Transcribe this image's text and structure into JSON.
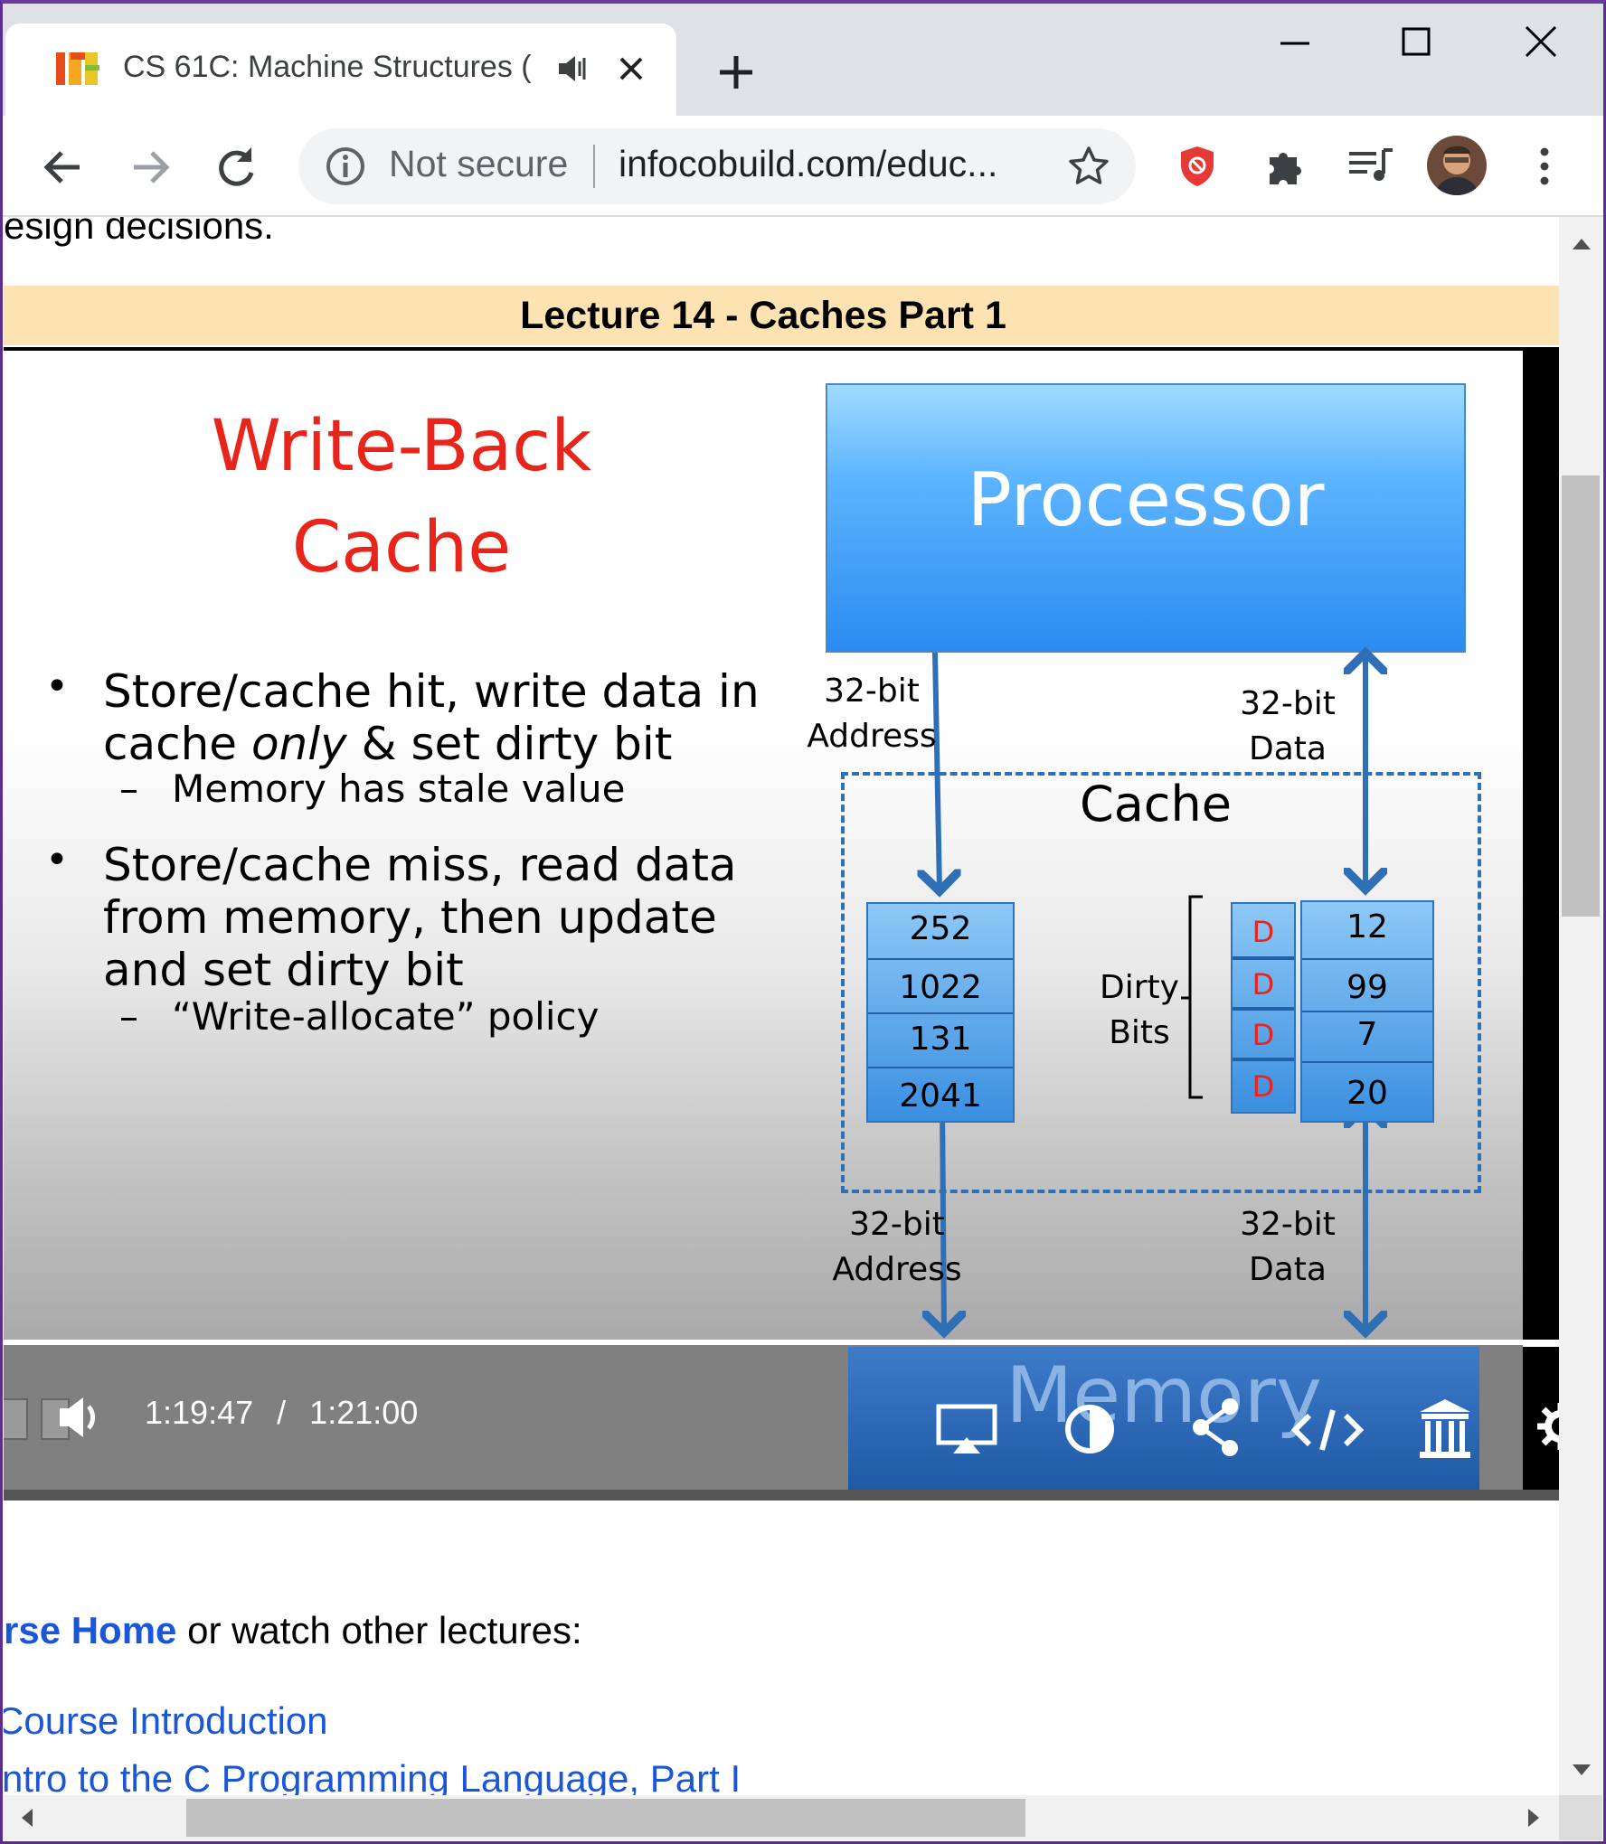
{
  "browser": {
    "tab": {
      "favicon": "icb-logo",
      "title": "CS 61C: Machine Structures (",
      "audio_icon": "speaker-icon",
      "close_icon": "close-icon"
    },
    "new_tab_icon": "plus-icon",
    "window_controls": [
      "minimize-icon",
      "maximize-icon",
      "close-icon"
    ],
    "nav": {
      "back_icon": "arrow-left-icon",
      "forward_icon": "arrow-right-icon",
      "reload_icon": "reload-icon"
    },
    "omnibox": {
      "security_icon": "info-icon",
      "security_text": "Not secure",
      "url": "infocobuild.com/educ...",
      "bookmark_icon": "star-icon"
    },
    "extensions": [
      "shield-extension-icon",
      "puzzle-icon",
      "media-control-icon"
    ],
    "menu_icon": "kebab-menu-icon",
    "colors": {
      "tab_strip": "#dee1e6",
      "link": "#1a56d6",
      "lecture_bar": "#fde3b1",
      "frame": "#5b2d8e"
    }
  },
  "page": {
    "partial_text": "esign decisions.",
    "lecture_title": "Lecture 14 - Caches Part 1",
    "slide": {
      "title_line1": "Write-Back",
      "title_line2": "Cache",
      "bullet1_pre": "Store/cache hit, write data in cache ",
      "bullet1_em": "only",
      "bullet1_post": " & set dirty bit",
      "sub1": "Memory has stale value",
      "bullet2": "Store/cache miss, read data from memory, then update and set dirty bit",
      "sub2": "“Write-allocate” policy",
      "dash": "–",
      "dot": "•",
      "processor_label": "Processor",
      "cache_label": "Cache",
      "addr_label_top_1": "32-bit",
      "addr_label_top_2": "Address",
      "data_label_top_1": "32-bit",
      "data_label_top_2": "Data",
      "addr_label_bottom_1": "32-bit",
      "addr_label_bottom_2": "Address",
      "data_label_bottom_1": "32-bit",
      "data_label_bottom_2": "Data",
      "dirty_label_1": "Dirty",
      "dirty_label_2": "Bits",
      "tags": [
        "252",
        "1022",
        "131",
        "2041"
      ],
      "dirty_bits": [
        "D",
        "D",
        "D",
        "D"
      ],
      "data_values": [
        "12",
        "99",
        "7",
        "20"
      ],
      "memory_label": "Memory"
    },
    "player": {
      "time_current": "1:19:47",
      "time_sep": "/",
      "time_total": "1:21:00",
      "icons": [
        "volume-icon",
        "airplay-icon",
        "theme-toggle-icon",
        "share-icon",
        "embed-icon",
        "archive-icon",
        "settings-icon"
      ]
    },
    "links": {
      "home_link": "rse Home",
      "home_suffix": " or watch other lectures:",
      "lectures": [
        "Course Introduction",
        "ntro to the C Programming Language, Part I"
      ]
    }
  }
}
